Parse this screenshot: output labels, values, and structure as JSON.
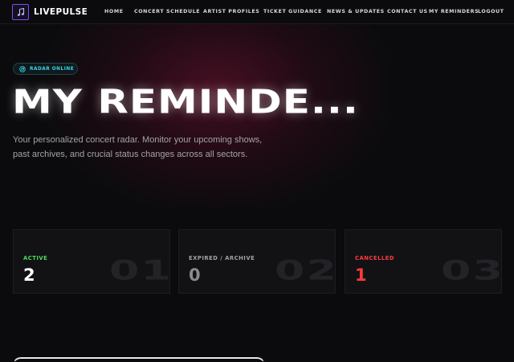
{
  "brand": {
    "name": "LIVEPULSE",
    "accent": "#7c4dff"
  },
  "nav": {
    "links": [
      {
        "label": "HOME"
      },
      {
        "label": "CONCERT SCHEDULE"
      },
      {
        "label": "ARTIST PROFILES"
      },
      {
        "label": "TICKET GUIDANCE"
      },
      {
        "label": "NEWS & UPDATES"
      },
      {
        "label": "CONTACT US"
      },
      {
        "label": "MY REMINDERS"
      },
      {
        "label": "LOGOUT"
      }
    ]
  },
  "hero": {
    "badge": {
      "label": "RADAR ONLINE",
      "icon": "radar-icon",
      "color": "#3fd3e0"
    },
    "title": "MY REMINDE...",
    "subtitle": "Your personalized concert radar. Monitor your upcoming shows, past archives, and crucial status changes across all sectors."
  },
  "stats": [
    {
      "label": "ACTIVE",
      "value": "2",
      "index": "01",
      "label_color": "#4ade5a",
      "value_color": "#ffffff"
    },
    {
      "label": "EXPIRED / ARCHIVE",
      "value": "0",
      "index": "02",
      "label_color": "#a3a3aa",
      "value_color": "#8a8a90"
    },
    {
      "label": "CANCELLED",
      "value": "1",
      "index": "03",
      "label_color": "#ff3b3b",
      "value_color": "#ff3b3b"
    }
  ]
}
